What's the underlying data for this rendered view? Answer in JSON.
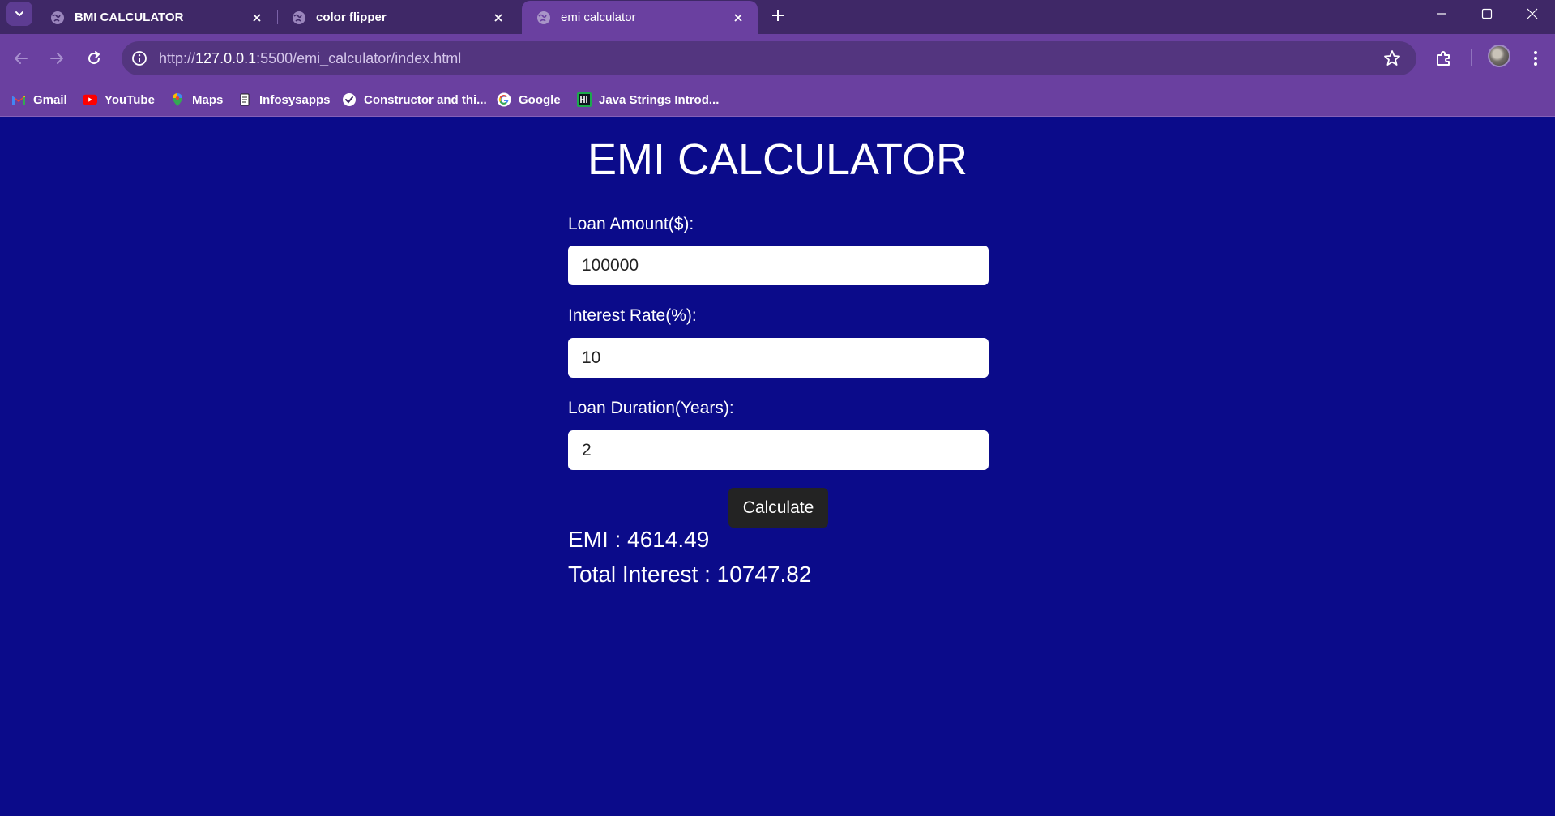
{
  "browser": {
    "tabs": [
      {
        "title": "BMI CALCULATOR",
        "active": false
      },
      {
        "title": "color flipper",
        "active": false
      },
      {
        "title": "emi calculator",
        "active": true
      }
    ],
    "address": {
      "scheme": "http://",
      "host": "127.0.0.1",
      "rest": ":5500/emi_calculator/index.html"
    },
    "bookmarks": [
      {
        "label": "Gmail",
        "icon": "gmail-icon"
      },
      {
        "label": "YouTube",
        "icon": "youtube-icon"
      },
      {
        "label": "Maps",
        "icon": "maps-icon"
      },
      {
        "label": "Infosysapps",
        "icon": "document-icon"
      },
      {
        "label": "Constructor and thi...",
        "icon": "badge-icon"
      },
      {
        "label": "Google",
        "icon": "google-icon"
      },
      {
        "label": "Java Strings Introd...",
        "icon": "hackerrank-icon"
      }
    ],
    "colors": {
      "tab_strip": "#3f2867",
      "toolbar": "#6a40a0",
      "omnibox": "#53357f"
    }
  },
  "app": {
    "title": "EMI CALCULATOR",
    "fields": [
      {
        "label": "Loan Amount($):",
        "value": "100000"
      },
      {
        "label": "Interest Rate(%):",
        "value": "10"
      },
      {
        "label": "Loan Duration(Years):",
        "value": "2"
      }
    ],
    "button_label": "Calculate",
    "results": {
      "emi": "EMI : 4614.49",
      "total_interest": "Total Interest : 10747.82"
    },
    "colors": {
      "background": "#0b0b8a",
      "button": "#232323"
    }
  }
}
